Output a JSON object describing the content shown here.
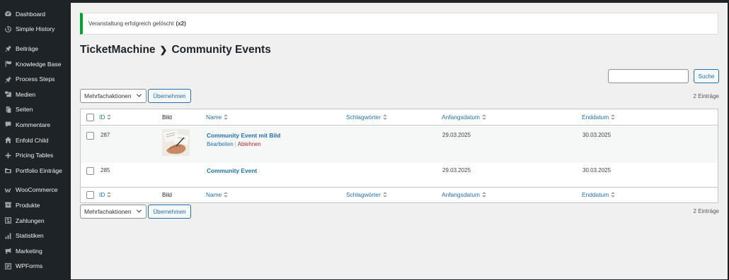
{
  "sidebar": {
    "items": [
      {
        "label": "Dashboard",
        "icon": "dashboard-icon"
      },
      {
        "label": "Simple History",
        "icon": "history-icon"
      },
      {
        "label": "Beiträge",
        "icon": "pin-icon"
      },
      {
        "label": "Knowledge Base",
        "icon": "flag-icon"
      },
      {
        "label": "Process Steps",
        "icon": "pin-icon"
      },
      {
        "label": "Medien",
        "icon": "media-icon"
      },
      {
        "label": "Seiten",
        "icon": "pages-icon"
      },
      {
        "label": "Kommentare",
        "icon": "comment-icon"
      },
      {
        "label": "Enfold Child",
        "icon": "home-icon"
      },
      {
        "label": "Pricing Tables",
        "icon": "plus-icon"
      },
      {
        "label": "Portfolio Einträge",
        "icon": "portfolio-icon"
      },
      {
        "label": "WooCommerce",
        "icon": "woo-icon"
      },
      {
        "label": "Produkte",
        "icon": "archive-icon"
      },
      {
        "label": "Zahlungen",
        "icon": "dollar-icon"
      },
      {
        "label": "Statistiken",
        "icon": "chart-bar-icon"
      },
      {
        "label": "Marketing",
        "icon": "megaphone-icon"
      },
      {
        "label": "WPForms",
        "icon": "forms-icon"
      }
    ]
  },
  "notice": {
    "text": "Veranstaltung erfolgreich gelöscht",
    "count": "(x2)",
    "color": "#00a32a"
  },
  "title": {
    "parent": "TicketMachine",
    "current": "Community Events"
  },
  "search": {
    "value": "",
    "button": "Suche"
  },
  "bulk": {
    "label": "Mehrfachaktionen",
    "apply": "Übernehmen"
  },
  "count": "2 Einträge",
  "columns": {
    "id": "ID",
    "image": "Bild",
    "name": "Name",
    "tags": "Schlagwörter",
    "start": "Anfangsdatum",
    "end": "Enddatum"
  },
  "rows": [
    {
      "id": "287",
      "name": "Community Event mit Bild",
      "start": "29.03.2025",
      "end": "30.03.2025",
      "edit": "Bearbeiten",
      "reject": "Ablehnen",
      "has_image": true
    },
    {
      "id": "285",
      "name": "Community Event",
      "start": "29.03.2025",
      "end": "30.03.2025",
      "has_image": false
    }
  ],
  "colors": {
    "accent": "#2271b1",
    "danger": "#b32d2e",
    "sidebar": "#1d2327",
    "success": "#00a32a"
  }
}
